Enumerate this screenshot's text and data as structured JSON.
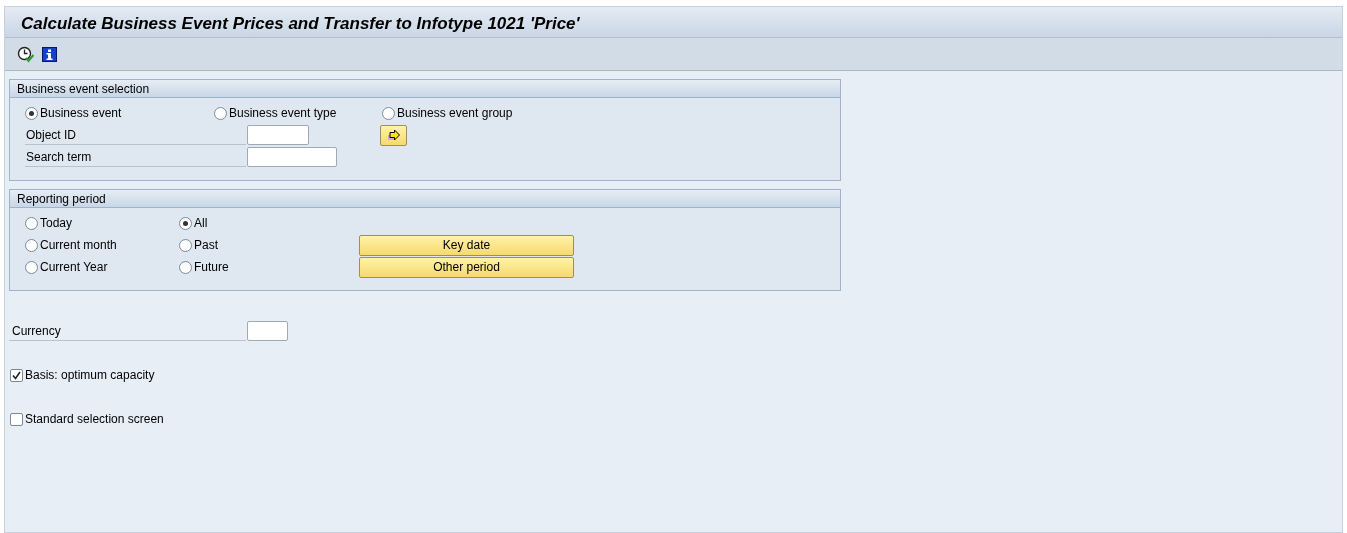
{
  "window": {
    "title": "Calculate Business Event Prices and Transfer to Infotype 1021 'Price'"
  },
  "toolbar": [
    {
      "kind": "execute"
    },
    {
      "kind": "info"
    }
  ],
  "event_selection": {
    "title": "Business event selection",
    "options": [
      {
        "label": "Business event",
        "selected": true
      },
      {
        "label": "Business event type",
        "selected": false
      },
      {
        "label": "Business event group",
        "selected": false
      }
    ],
    "fields": [
      {
        "label": "Object ID"
      },
      {
        "label": "Search term"
      }
    ]
  },
  "reporting_period": {
    "title": "Reporting period",
    "column_1": [
      {
        "label": "Today",
        "selected": false
      },
      {
        "label": "Current month",
        "selected": false
      },
      {
        "label": "Current Year",
        "selected": false
      }
    ],
    "column_2": [
      {
        "label": "All",
        "selected": true
      },
      {
        "label": "Past",
        "selected": false
      },
      {
        "label": "Future",
        "selected": false
      }
    ],
    "buttons": [
      "Key date",
      "Other period"
    ]
  },
  "currency": {
    "label": "Currency"
  },
  "checkboxes": [
    {
      "label": "Basis: optimum capacity",
      "checked": true
    },
    {
      "label": "Standard selection screen",
      "checked": false
    }
  ]
}
